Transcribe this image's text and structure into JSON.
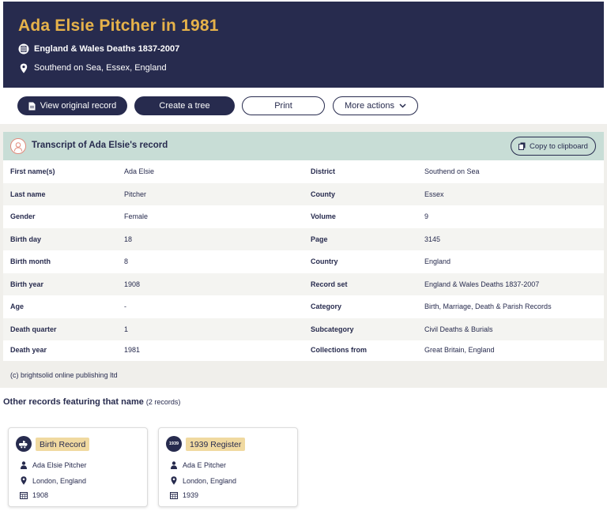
{
  "header": {
    "title": "Ada Elsie Pitcher in 1981",
    "collection": "England & Wales Deaths 1837-2007",
    "location": "Southend on Sea, Essex, England"
  },
  "actions": {
    "view_original": "View original record",
    "create_tree": "Create a tree",
    "print": "Print",
    "more_actions": "More actions"
  },
  "transcript": {
    "title": "Transcript of Ada Elsie's record",
    "copy_label": "Copy to clipboard",
    "rows": [
      {
        "left_key": "First name(s)",
        "left_val": "Ada Elsie",
        "right_key": "District",
        "right_val": "Southend on Sea"
      },
      {
        "left_key": "Last name",
        "left_val": "Pitcher",
        "right_key": "County",
        "right_val": "Essex"
      },
      {
        "left_key": "Gender",
        "left_val": "Female",
        "right_key": "Volume",
        "right_val": "9"
      },
      {
        "left_key": "Birth day",
        "left_val": "18",
        "right_key": "Page",
        "right_val": "3145"
      },
      {
        "left_key": "Birth month",
        "left_val": "8",
        "right_key": "Country",
        "right_val": "England"
      },
      {
        "left_key": "Birth year",
        "left_val": "1908",
        "right_key": "Record set",
        "right_val": "England & Wales Deaths 1837-2007"
      },
      {
        "left_key": "Age",
        "left_val": "-",
        "right_key": "Category",
        "right_val": "Birth, Marriage, Death & Parish Records"
      },
      {
        "left_key": "Death quarter",
        "left_val": "1",
        "right_key": "Subcategory",
        "right_val": "Civil Deaths & Burials"
      },
      {
        "left_key": "Death year",
        "left_val": "1981",
        "right_key": "Collections from",
        "right_val": "Great Britain, England"
      }
    ],
    "copyright": "(c) brightsolid online publishing ltd"
  },
  "other_records": {
    "title": "Other records featuring that name",
    "count": "(2 records)",
    "cards": [
      {
        "tag": "Birth Record",
        "badge_icon": "pram-icon",
        "badge_text": "",
        "name": "Ada Elsie Pitcher",
        "place": "London, England",
        "year": "1908"
      },
      {
        "tag": "1939 Register",
        "badge_icon": "register-1939-icon",
        "badge_text": "1939",
        "name": "Ada E Pitcher",
        "place": "London, England",
        "year": "1939"
      }
    ]
  },
  "colors": {
    "navy": "#272b4e",
    "gold": "#e6b24a",
    "mint": "#c8ddd6",
    "tag": "#f0d9a0"
  }
}
